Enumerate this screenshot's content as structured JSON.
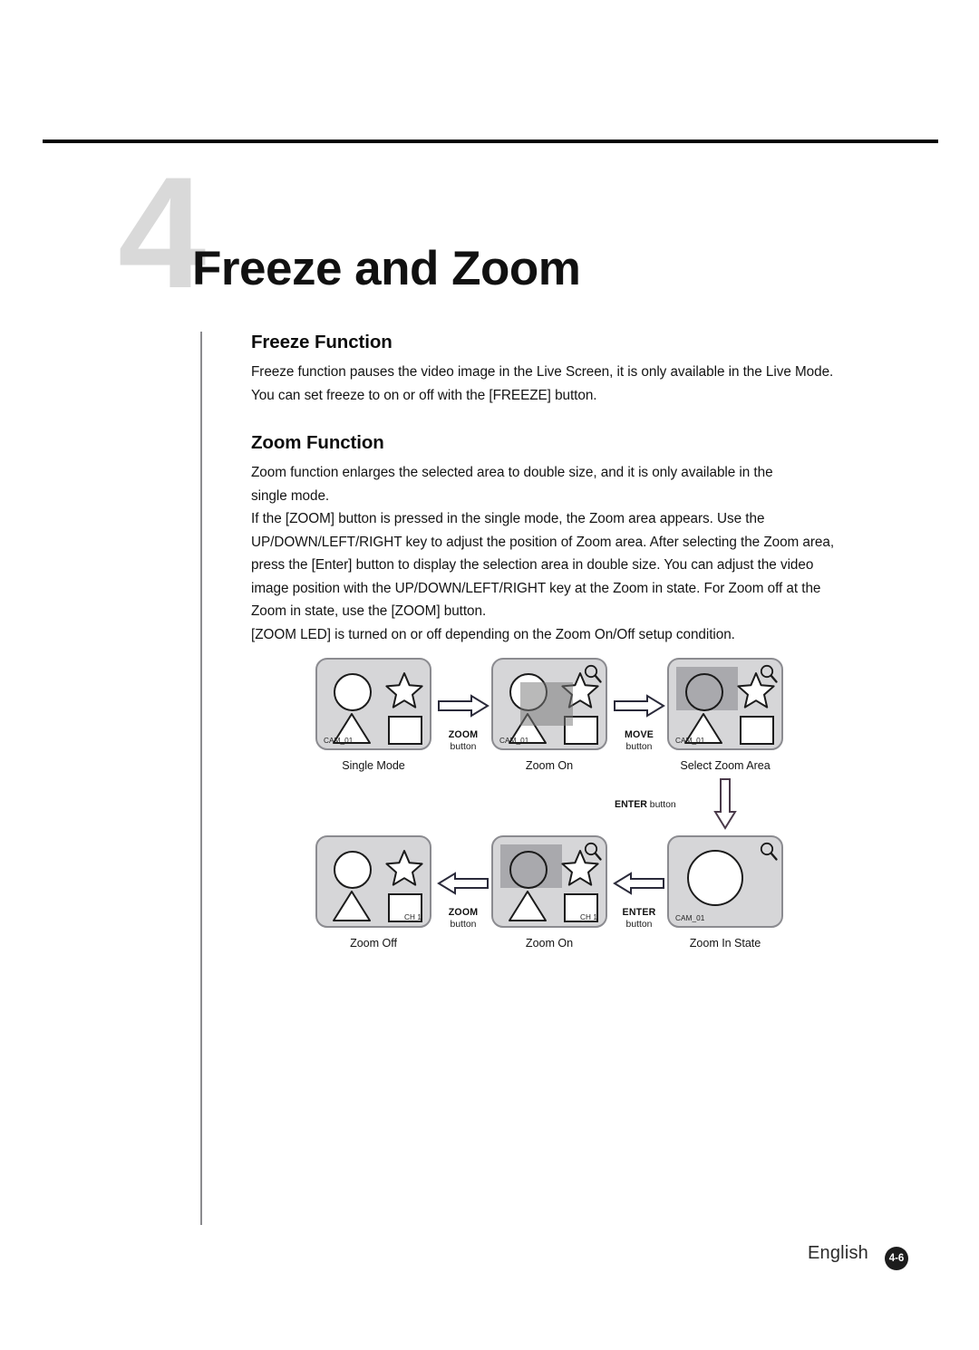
{
  "page": {
    "chapter_number": "4",
    "chapter_title": "Freeze and Zoom",
    "footer_language": "English",
    "footer_page": "4-6"
  },
  "sections": [
    {
      "heading": "Freeze Function",
      "lines": [
        "Freeze function pauses the video image in the Live Screen, it is only available in the Live Mode.",
        "You can set freeze to on or off with the [FREEZE] button."
      ]
    },
    {
      "heading": "Zoom Function",
      "lines": [
        "Zoom function enlarges the selected area to double size, and it is only available in the",
        "single mode.",
        "If the [ZOOM] button is pressed in the single mode, the Zoom area appears. Use the",
        "UP/DOWN/LEFT/RIGHT key to adjust the position of Zoom area. After selecting the Zoom area,",
        "press the [Enter] button to display the selection area in double size. You can adjust the video",
        "image position with the UP/DOWN/LEFT/RIGHT key at the Zoom in state. For Zoom off at the",
        "Zoom in state, use the [ZOOM] button.",
        "[ZOOM LED] is turned on or off depending on the Zoom On/Off setup condition."
      ]
    }
  ],
  "diagram": {
    "panels": {
      "single_mode": {
        "caption": "Single Mode",
        "cam": "CAM_01"
      },
      "zoom_on_top": {
        "caption": "Zoom On",
        "cam": "CAM_01"
      },
      "select_zoom_area": {
        "caption": "Select Zoom Area",
        "cam": "CAM_01"
      },
      "zoom_in_state": {
        "caption": "Zoom In State",
        "cam": "CAM_01"
      },
      "zoom_on_bottom": {
        "caption": "Zoom On",
        "cam": "CH 1"
      },
      "zoom_off": {
        "caption": "Zoom Off",
        "cam": "CH 1"
      }
    },
    "transitions": {
      "zoom_1": {
        "name": "ZOOM",
        "sub": "button"
      },
      "move_1": {
        "name": "MOVE",
        "sub": "button"
      },
      "enter_v": {
        "name": "ENTER",
        "sub": "button"
      },
      "enter_2": {
        "name": "ENTER",
        "sub": "button"
      },
      "zoom_2": {
        "name": "ZOOM",
        "sub": "button"
      }
    },
    "colors": {
      "panel_fill": "#d6d6d8",
      "panel_border": "#8b8b90",
      "selection": "#a9a9ad",
      "chapter_number": "#d9d9d9"
    }
  }
}
